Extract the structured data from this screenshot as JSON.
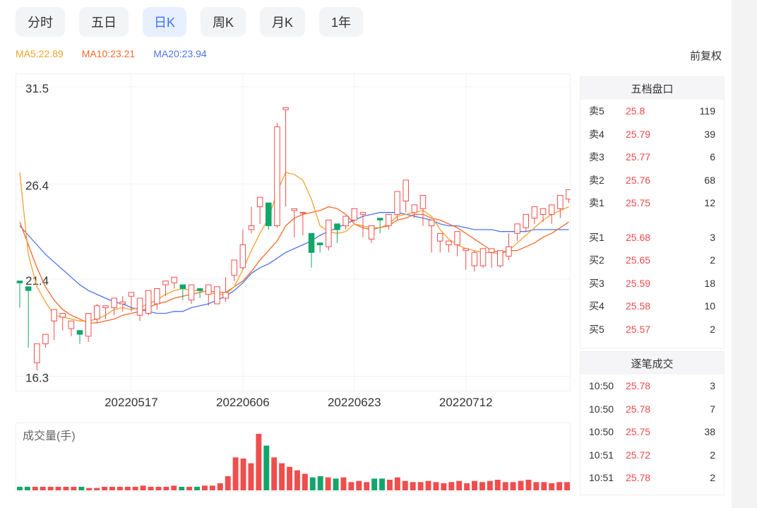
{
  "tabs": [
    {
      "label": "分时",
      "active": false
    },
    {
      "label": "五日",
      "active": false
    },
    {
      "label": "日K",
      "active": true
    },
    {
      "label": "周K",
      "active": false
    },
    {
      "label": "月K",
      "active": false
    },
    {
      "label": "1年",
      "active": false
    }
  ],
  "ma": {
    "ma5": "MA5:22.89",
    "ma10": "MA10:23.21",
    "ma20": "MA20:23.94"
  },
  "adjust_label": "前复权",
  "colors": {
    "up": "#f04d4d",
    "down": "#12a66a",
    "ma5": "#f2a12b",
    "ma10": "#f26a2b",
    "ma20": "#4f74e8",
    "accent": "#3a73ff"
  },
  "volume_label": "成交量(手)",
  "order_book": {
    "title": "五档盘口",
    "sell": [
      {
        "label": "卖5",
        "price": "25.8",
        "vol": "119"
      },
      {
        "label": "卖4",
        "price": "25.79",
        "vol": "39"
      },
      {
        "label": "卖3",
        "price": "25.77",
        "vol": "6"
      },
      {
        "label": "卖2",
        "price": "25.76",
        "vol": "68"
      },
      {
        "label": "卖1",
        "price": "25.75",
        "vol": "12"
      }
    ],
    "buy": [
      {
        "label": "买1",
        "price": "25.68",
        "vol": "3"
      },
      {
        "label": "买2",
        "price": "25.65",
        "vol": "2"
      },
      {
        "label": "买3",
        "price": "25.59",
        "vol": "18"
      },
      {
        "label": "买4",
        "price": "25.58",
        "vol": "10"
      },
      {
        "label": "买5",
        "price": "25.57",
        "vol": "2"
      }
    ]
  },
  "trades": {
    "title": "逐笔成交",
    "rows": [
      {
        "time": "10:50",
        "price": "25.78",
        "vol": "3"
      },
      {
        "time": "10:50",
        "price": "25.78",
        "vol": "7"
      },
      {
        "time": "10:50",
        "price": "25.75",
        "vol": "38"
      },
      {
        "time": "10:51",
        "price": "25.72",
        "vol": "2"
      },
      {
        "time": "10:51",
        "price": "25.78",
        "vol": "2"
      }
    ]
  },
  "chart_data": {
    "type": "candlestick",
    "y_ticks": [
      "31.5",
      "26.4",
      "21.4",
      "16.3"
    ],
    "ylim": [
      15.5,
      32.2
    ],
    "x_ticks": [
      {
        "label": "20220517",
        "index": 13
      },
      {
        "label": "20220606",
        "index": 26
      },
      {
        "label": "20220623",
        "index": 39
      },
      {
        "label": "20220712",
        "index": 52
      }
    ],
    "candles": [
      [
        21.3,
        21.2,
        20.0,
        19.9
      ],
      [
        21.0,
        20.8,
        18.2,
        17.8
      ],
      [
        17.0,
        18.0,
        17.2,
        16.6
      ],
      [
        18.0,
        18.5,
        18.2,
        17.8
      ],
      [
        19.2,
        19.8,
        18.4,
        18.2
      ],
      [
        19.4,
        19.6,
        19.0,
        18.7
      ],
      [
        18.8,
        19.2,
        19.1,
        18.4
      ],
      [
        18.7,
        18.5,
        18.3,
        18.0
      ],
      [
        18.4,
        19.6,
        18.5,
        18.1
      ],
      [
        19.3,
        20.0,
        20.1,
        19.1
      ],
      [
        19.9,
        20.0,
        19.5,
        19.3
      ],
      [
        19.9,
        20.4,
        20.2,
        19.5
      ],
      [
        20.1,
        20.2,
        20.5,
        19.7
      ],
      [
        20.5,
        20.7,
        19.7,
        19.7
      ],
      [
        19.5,
        20.4,
        19.3,
        19.2
      ],
      [
        19.6,
        20.8,
        20.6,
        19.5
      ],
      [
        20.1,
        20.9,
        20.6,
        19.8
      ],
      [
        21.1,
        21.3,
        21.2,
        20.5
      ],
      [
        21.2,
        21.5,
        21.3,
        20.9
      ],
      [
        21.1,
        20.9,
        20.4,
        20.3
      ],
      [
        20.3,
        21.1,
        20.9,
        20.1
      ],
      [
        20.9,
        20.8,
        20.6,
        20.4
      ],
      [
        20.6,
        21.1,
        20.1,
        20.0
      ],
      [
        20.1,
        21.0,
        20.4,
        20.1
      ],
      [
        20.4,
        20.7,
        21.5,
        20.2
      ],
      [
        21.6,
        22.4,
        22.0,
        21.3
      ],
      [
        22.0,
        23.2,
        24.0,
        21.9
      ],
      [
        24.0,
        24.2,
        25.2,
        23.8
      ],
      [
        25.2,
        25.7,
        25.4,
        24.3
      ],
      [
        25.4,
        24.2,
        24.7,
        24.0
      ],
      [
        24.2,
        29.4,
        29.6,
        24.1
      ],
      [
        30.3,
        30.4,
        25.6,
        25.2
      ],
      [
        25.0,
        25.1,
        24.7,
        23.6
      ],
      [
        24.9,
        24.9,
        23.8,
        23.7
      ],
      [
        23.8,
        22.8,
        23.4,
        22.0
      ],
      [
        23.3,
        23.2,
        22.9,
        22.8
      ],
      [
        23.1,
        24.5,
        24.5,
        22.9
      ],
      [
        24.3,
        24.0,
        24.2,
        23.3
      ],
      [
        24.2,
        24.7,
        24.4,
        24.0
      ],
      [
        24.5,
        25.1,
        24.7,
        24.4
      ],
      [
        24.8,
        24.9,
        23.6,
        23.6
      ],
      [
        23.5,
        24.2,
        24.2,
        23.3
      ],
      [
        24.6,
        24.5,
        23.9,
        23.8
      ],
      [
        24.2,
        24.8,
        24.7,
        24.0
      ],
      [
        24.8,
        26.0,
        25.8,
        24.5
      ],
      [
        25.5,
        26.6,
        25.0,
        24.9
      ],
      [
        24.9,
        25.3,
        25.1,
        24.6
      ],
      [
        25.1,
        25.8,
        24.6,
        24.2
      ],
      [
        24.2,
        24.5,
        23.2,
        22.8
      ],
      [
        23.4,
        23.8,
        23.1,
        22.8
      ],
      [
        23.2,
        23.4,
        23.0,
        22.8
      ],
      [
        23.2,
        23.9,
        22.8,
        22.6
      ],
      [
        22.9,
        23.0,
        22.2,
        21.9
      ],
      [
        22.1,
        22.8,
        22.9,
        21.8
      ],
      [
        22.1,
        23.0,
        22.8,
        22.0
      ],
      [
        22.8,
        23.0,
        22.2,
        22.0
      ],
      [
        22.1,
        22.9,
        22.6,
        22.0
      ],
      [
        22.6,
        23.1,
        23.8,
        22.4
      ],
      [
        23.8,
        24.3,
        24.1,
        23.4
      ],
      [
        24.1,
        24.8,
        24.6,
        23.9
      ],
      [
        24.6,
        25.2,
        24.9,
        24.3
      ],
      [
        24.8,
        25.1,
        25.0,
        24.4
      ],
      [
        24.8,
        25.3,
        25.1,
        24.3
      ],
      [
        25.1,
        25.8,
        25.6,
        24.6
      ],
      [
        25.6,
        26.1,
        25.8,
        25.4
      ]
    ],
    "ma5": [
      27,
      22.7,
      21.0,
      20.2,
      19.5,
      19.4,
      19.3,
      19.2,
      19.2,
      19.3,
      19.5,
      19.8,
      19.9,
      19.8,
      19.9,
      20.1,
      20.3,
      20.6,
      20.8,
      20.9,
      20.8,
      20.8,
      20.7,
      20.6,
      20.6,
      21.0,
      21.9,
      22.9,
      23.8,
      24.6,
      26.0,
      27.0,
      26.9,
      26.6,
      25.6,
      24.2,
      23.9,
      23.8,
      23.9,
      24.3,
      24.2,
      24.1,
      24.1,
      24.3,
      24.7,
      24.8,
      24.9,
      25.0,
      24.7,
      24.0,
      23.5,
      23.2,
      23.0,
      22.9,
      22.8,
      22.8,
      22.7,
      22.9,
      23.3,
      23.7,
      24.1,
      24.5,
      24.8,
      25.0,
      25.2
    ],
    "ma10": [
      24.4,
      23.2,
      22.0,
      21.0,
      20.3,
      19.8,
      19.5,
      19.3,
      19.1,
      19.1,
      19.2,
      19.3,
      19.5,
      19.6,
      19.7,
      19.9,
      20.1,
      20.2,
      20.4,
      20.5,
      20.6,
      20.7,
      20.8,
      20.7,
      20.7,
      21.0,
      21.3,
      21.8,
      22.4,
      22.9,
      23.4,
      24.2,
      24.6,
      24.8,
      24.9,
      25.0,
      25.2,
      25.1,
      24.8,
      24.3,
      24.1,
      24.0,
      24.1,
      24.2,
      24.5,
      24.6,
      24.8,
      24.8,
      24.6,
      24.5,
      24.3,
      24.1,
      23.8,
      23.5,
      23.2,
      22.9,
      22.8,
      22.9,
      22.9,
      23.1,
      23.3,
      23.6,
      23.8,
      24.1,
      24.4
    ],
    "ma20": [
      24.2,
      23.7,
      23.2,
      22.7,
      22.3,
      21.9,
      21.5,
      21.1,
      20.8,
      20.6,
      20.4,
      20.2,
      20.1,
      19.9,
      19.8,
      19.7,
      19.6,
      19.6,
      19.7,
      19.7,
      19.9,
      20.0,
      20.1,
      20.3,
      20.5,
      20.8,
      21.2,
      21.7,
      22.0,
      22.2,
      22.5,
      22.8,
      23.0,
      23.2,
      23.4,
      23.7,
      23.9,
      24.1,
      24.3,
      24.5,
      24.7,
      24.8,
      24.9,
      24.9,
      24.9,
      24.8,
      24.7,
      24.6,
      24.5,
      24.3,
      24.2,
      24.2,
      24.1,
      24.0,
      24.0,
      24.0,
      23.9,
      23.9,
      23.9,
      23.9,
      24.0,
      24.0,
      24.0,
      24.0,
      24.0
    ],
    "volumes": [
      3,
      3,
      3,
      3,
      3,
      3,
      3,
      3,
      3,
      2,
      2,
      3,
      3,
      3,
      3,
      3,
      4,
      3,
      3,
      3,
      4,
      3,
      3,
      3,
      4,
      4,
      6,
      12,
      28,
      27,
      23,
      48,
      38,
      28,
      23,
      20,
      17,
      14,
      11,
      12,
      11,
      10,
      11,
      7,
      8,
      7,
      10,
      10,
      9,
      11,
      8,
      7,
      7,
      8,
      7,
      6,
      7,
      8,
      6,
      8,
      7,
      8,
      9,
      7,
      7,
      8,
      9,
      7,
      7,
      6,
      7,
      7
    ]
  }
}
